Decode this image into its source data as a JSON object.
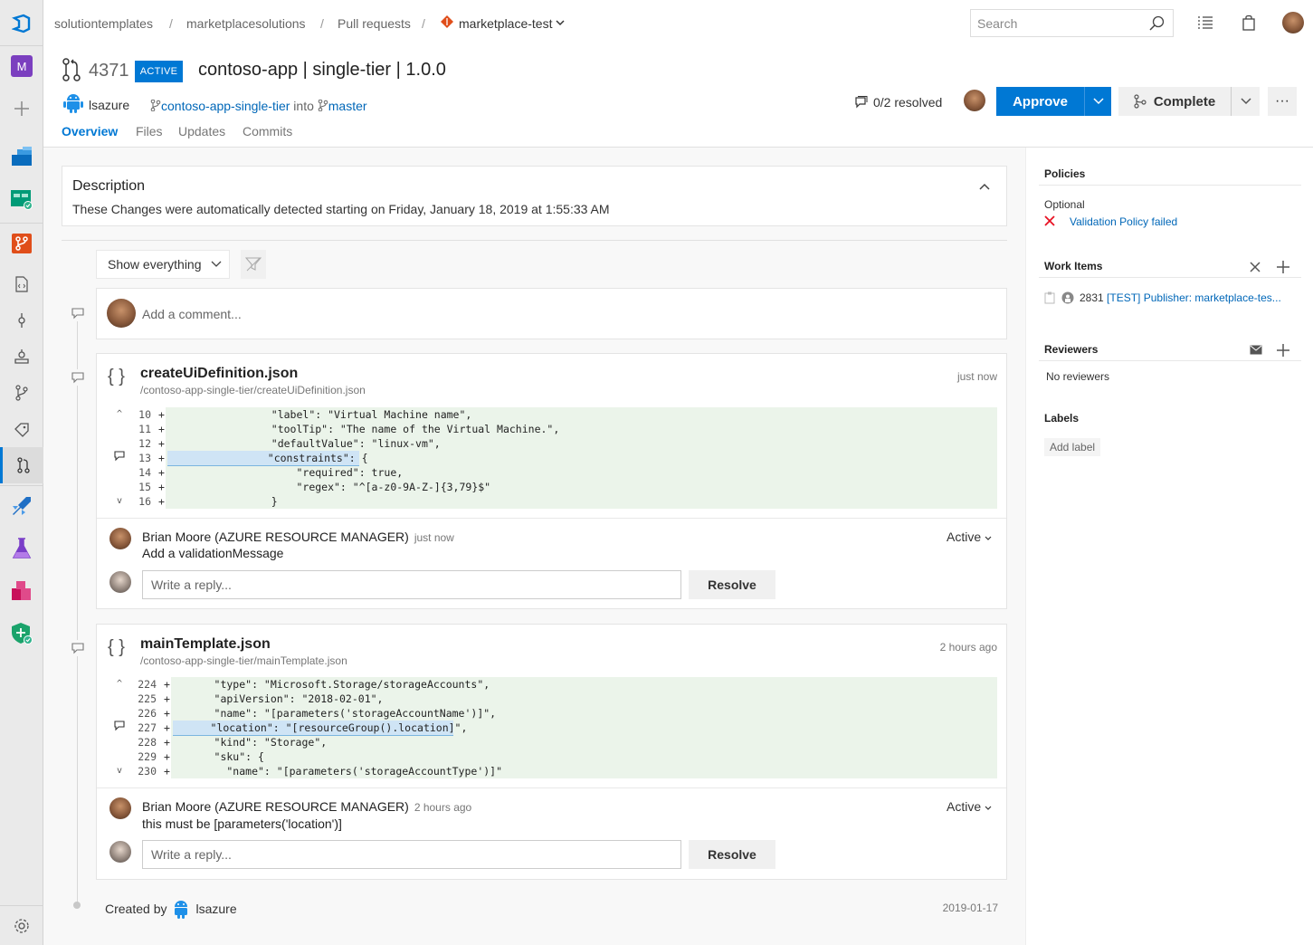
{
  "breadcrumb": {
    "org": "solutiontemplates",
    "project": "marketplacesolutions",
    "section": "Pull requests",
    "repo": "marketplace-test"
  },
  "search": {
    "placeholder": "Search"
  },
  "nav": {
    "org_letter": "M"
  },
  "pr": {
    "number": "4371",
    "status": "ACTIVE",
    "title": "contoso-app | single-tier | 1.0.0",
    "author": "lsazure",
    "source_branch": "contoso-app-single-tier",
    "into": "into",
    "target_branch": "master",
    "resolved": "0/2 resolved",
    "approve_label": "Approve",
    "complete_label": "Complete",
    "more_label": "···"
  },
  "tabs": [
    "Overview",
    "Files",
    "Updates",
    "Commits"
  ],
  "description": {
    "title": "Description",
    "text": "These Changes were automatically detected starting on Friday, January 18, 2019 at 1:55:33 AM"
  },
  "filter": {
    "label": "Show everything"
  },
  "comment": {
    "placeholder": "Add a comment..."
  },
  "threads": [
    {
      "file_name": "createUiDefinition.json",
      "file_path": "/contoso-app-single-tier/createUiDefinition.json",
      "time": "just now",
      "lines": [
        {
          "num": "10",
          "plus": "+",
          "code": "                \"label\": \"Virtual Machine name\","
        },
        {
          "num": "11",
          "plus": "+",
          "code": "                \"toolTip\": \"The name of the Virtual Machine.\","
        },
        {
          "num": "12",
          "plus": "+",
          "code": "                \"defaultValue\": \"linux-vm\","
        },
        {
          "num": "13",
          "plus": "+",
          "code": "                \"constraints\": {"
        },
        {
          "num": "14",
          "plus": "+",
          "code": "                    \"required\": true,"
        },
        {
          "num": "15",
          "plus": "+",
          "code": "                    \"regex\": \"^[a-z0-9A-Z-]{3,79}$\""
        },
        {
          "num": "16",
          "plus": "+",
          "code": "                }"
        }
      ],
      "comment_author": "Brian Moore (AZURE RESOURCE MANAGER)",
      "comment_time": "just now",
      "comment_text": "Add a validationMessage",
      "status": "Active",
      "reply_placeholder": "Write a reply...",
      "resolve_label": "Resolve"
    },
    {
      "file_name": "mainTemplate.json",
      "file_path": "/contoso-app-single-tier/mainTemplate.json",
      "time": "2 hours ago",
      "lines": [
        {
          "num": "224",
          "plus": "+",
          "code": "      \"type\": \"Microsoft.Storage/storageAccounts\","
        },
        {
          "num": "225",
          "plus": "+",
          "code": "      \"apiVersion\": \"2018-02-01\","
        },
        {
          "num": "226",
          "plus": "+",
          "code": "      \"name\": \"[parameters('storageAccountName')]\","
        },
        {
          "num": "227",
          "plus": "+",
          "code": "      \"location\": \"[resourceGroup().location]\","
        },
        {
          "num": "228",
          "plus": "+",
          "code": "      \"kind\": \"Storage\","
        },
        {
          "num": "229",
          "plus": "+",
          "code": "      \"sku\": {"
        },
        {
          "num": "230",
          "plus": "+",
          "code": "        \"name\": \"[parameters('storageAccountType')]\""
        }
      ],
      "comment_author": "Brian Moore (AZURE RESOURCE MANAGER)",
      "comment_time": "2 hours ago",
      "comment_text": "this must be [parameters('location')]",
      "status": "Active",
      "reply_placeholder": "Write a reply...",
      "resolve_label": "Resolve"
    }
  ],
  "created": {
    "label": "Created by",
    "author": "lsazure",
    "date": "2019-01-17"
  },
  "sidebar": {
    "policies_title": "Policies",
    "optional_label": "Optional",
    "policy_failed": "Validation Policy failed",
    "work_items_title": "Work Items",
    "work_item_id": "2831",
    "work_item_title": "[TEST] Publisher: marketplace-tes...",
    "reviewers_title": "Reviewers",
    "no_reviewers": "No reviewers",
    "labels_title": "Labels",
    "add_label": "Add label"
  },
  "colors": {
    "accent": "#0078d4",
    "error": "#e81123",
    "diff_add": "#ebf4ea",
    "org_badge": "#7b3fbf"
  }
}
